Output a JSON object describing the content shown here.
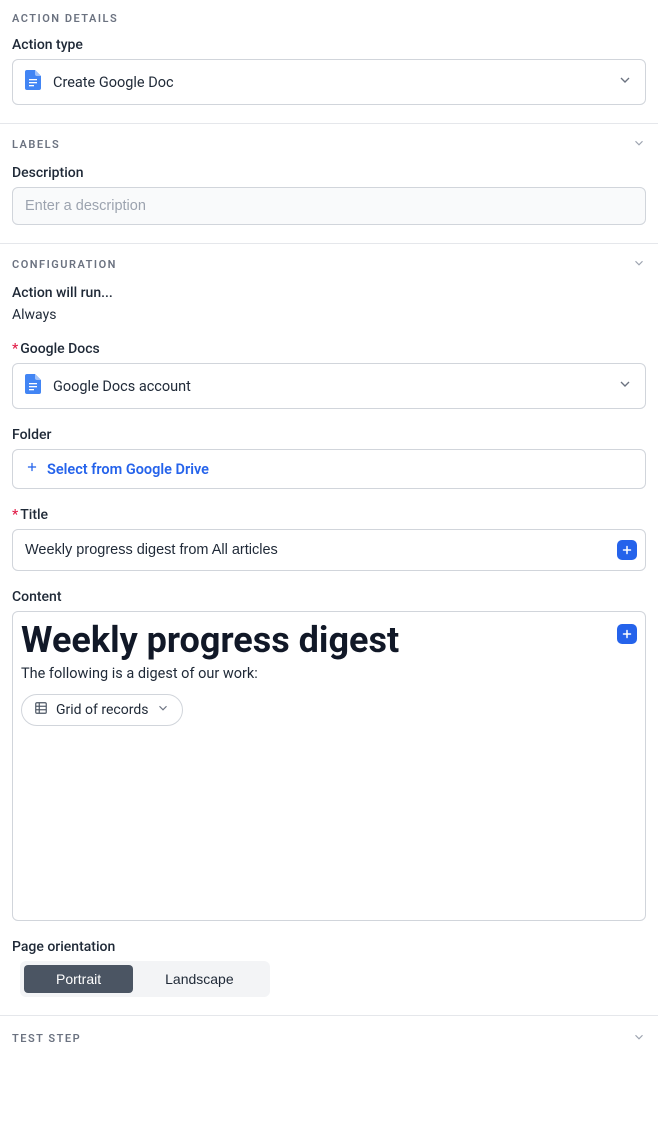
{
  "sections": {
    "action_details": {
      "title": "ACTION DETAILS"
    },
    "labels": {
      "title": "LABELS"
    },
    "configuration": {
      "title": "CONFIGURATION"
    },
    "test_step": {
      "title": "TEST STEP"
    }
  },
  "action_type": {
    "label": "Action type",
    "value": "Create Google Doc"
  },
  "description": {
    "label": "Description",
    "placeholder": "Enter a description"
  },
  "run": {
    "label": "Action will run...",
    "value": "Always"
  },
  "google_docs": {
    "label": "Google Docs",
    "value": "Google Docs account"
  },
  "folder": {
    "label": "Folder",
    "link_text": "Select from Google Drive"
  },
  "title": {
    "label": "Title",
    "value": "Weekly progress digest from All articles"
  },
  "content": {
    "label": "Content",
    "heading": "Weekly progress digest",
    "subtext": "The following is a digest of our work:",
    "chip_label": "Grid of records"
  },
  "orientation": {
    "label": "Page orientation",
    "portrait": "Portrait",
    "landscape": "Landscape"
  }
}
